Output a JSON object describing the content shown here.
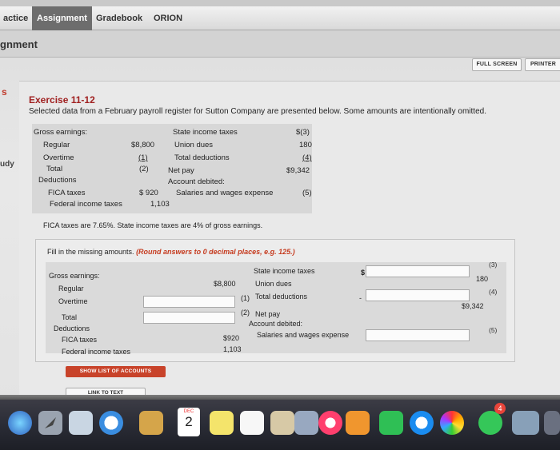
{
  "tabs": [
    {
      "label": "actice",
      "active": false
    },
    {
      "label": "Assignment",
      "active": true
    },
    {
      "label": "Gradebook",
      "active": false
    },
    {
      "label": "ORION",
      "active": false
    }
  ],
  "assignment_title": "gnment",
  "buttons": {
    "full_screen": "FULL SCREEN",
    "printer": "PRINTER"
  },
  "left_marks": {
    "s": "s",
    "udy": "udy"
  },
  "exercise": {
    "title": "Exercise 11-12",
    "description": "Selected data from a February payroll register for Sutton Company are presented below. Some amounts are intentionally omitted."
  },
  "data_table": {
    "gross_earnings": "Gross earnings:",
    "regular": "Regular",
    "regular_amount": "$8,800",
    "overtime": "Overtime",
    "overtime_amount": "(1)",
    "total": "Total",
    "total_amount": "(2)",
    "deductions": "Deductions",
    "fica_taxes": "FICA taxes",
    "fica_amount": "$ 920",
    "federal_income_taxes": "Federal income taxes",
    "federal_amount": "1,103",
    "state_income_taxes": "State income taxes",
    "state_amount": "$(3)",
    "union_dues": "Union dues",
    "union_amount": "180",
    "total_deductions": "Total deductions",
    "total_deductions_amount": "(4)",
    "net_pay": "Net pay",
    "net_pay_amount": "$9,342",
    "account_debited": "Account debited:",
    "salaries_wages": "Salaries and wages expense",
    "salaries_amount": "(5)"
  },
  "fica_note": "FICA taxes are 7.65%. State income taxes are 4% of gross earnings.",
  "fill": {
    "instruction": "Fill in the missing amounts.",
    "emphasis": "(Round answers to 0 decimal places, e.g. 125.)",
    "gross_earnings": "Gross earnings:",
    "regular": "Regular",
    "regular_amount": "$8,800",
    "overtime": "Overtime",
    "total": "Total",
    "deductions": "Deductions",
    "fica_taxes": "FICA taxes",
    "fica_amount": "$920",
    "federal_income_taxes": "Federal income taxes",
    "federal_amount": "1,103",
    "marker_1": "(1)",
    "marker_2": "(2)",
    "state_income_taxes": "State income taxes",
    "union_dues": "Union dues",
    "total_deductions": "Total deductions",
    "net_pay": "Net pay",
    "account_debited": "Account debited:",
    "salaries_wages": "Salaries and wages expense",
    "dollar_sign": "$",
    "union_amount": "180",
    "net_pay_amount": "$9,342",
    "marker_3": "(3)",
    "marker_4": "(4)",
    "marker_5": "(5)",
    "dash": "-"
  },
  "action_buttons": {
    "show_list": "SHOW LIST OF ACCOUNTS",
    "link_to_text": "LINK TO TEXT"
  },
  "dock": {
    "calendar_month": "DEC",
    "calendar_day": "2",
    "badge_count": "4",
    "icons": [
      "siri-icon",
      "launchpad-icon",
      "preview-icon",
      "safari-icon",
      "notes-app-icon",
      "calendar-icon",
      "sticky-notes-icon",
      "reminders-icon",
      "keynote-icon",
      "photo-icon",
      "music-icon",
      "books-icon",
      "facetime-icon",
      "app-store-icon",
      "photos-icon",
      "messages-icon",
      "image-capture-icon"
    ]
  }
}
